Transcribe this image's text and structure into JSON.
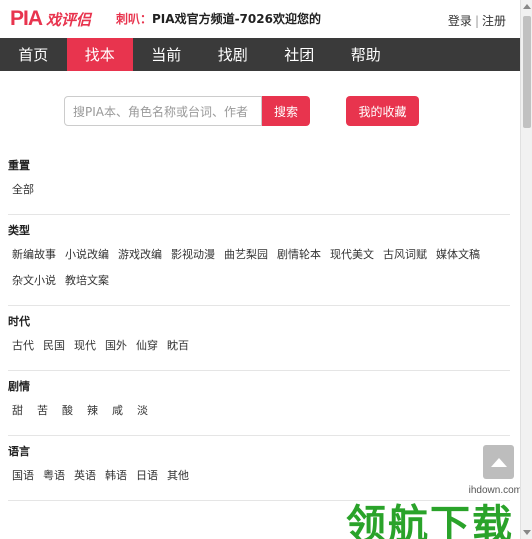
{
  "header": {
    "logo_text": "PIA",
    "logo_cn": "戏评侣",
    "marquee_label": "刺叭：",
    "marquee_msg": "PIA戏官方频道-7026欢迎您的",
    "login": "登录",
    "register": "注册",
    "separator": "|"
  },
  "nav": {
    "items": [
      "首页",
      "找本",
      "当前",
      "找剧",
      "社团",
      "帮助"
    ],
    "active": "找本"
  },
  "search": {
    "placeholder": "搜PIA本、角色名称或台词、作者",
    "search_label": "搜索",
    "favorites_label": "我的收藏"
  },
  "filters": [
    {
      "title": "重置",
      "options": [
        "全部"
      ]
    },
    {
      "title": "类型",
      "options": [
        "新编故事",
        "小说改编",
        "游戏改编",
        "影视动漫",
        "曲艺梨园",
        "剧情轮本",
        "现代美文",
        "古风词赋",
        "媒体文稿",
        "杂文小说",
        "教培文案"
      ]
    },
    {
      "title": "时代",
      "options": [
        "古代",
        "民国",
        "现代",
        "国外",
        "仙穿",
        "眈百"
      ]
    },
    {
      "title": "剧情",
      "options": [
        "甜",
        "苦",
        "酸",
        "辣",
        "咸",
        "淡"
      ]
    },
    {
      "title": "语言",
      "options": [
        "国语",
        "粤语",
        "英语",
        "韩语",
        "日语",
        "其他"
      ]
    }
  ],
  "watermark": {
    "site": "ihdown.com",
    "text": "领航下载"
  },
  "colors": {
    "accent": "#e8344e",
    "nav_bg": "#3a3a3a",
    "watermark_green": "#2aa32a"
  }
}
